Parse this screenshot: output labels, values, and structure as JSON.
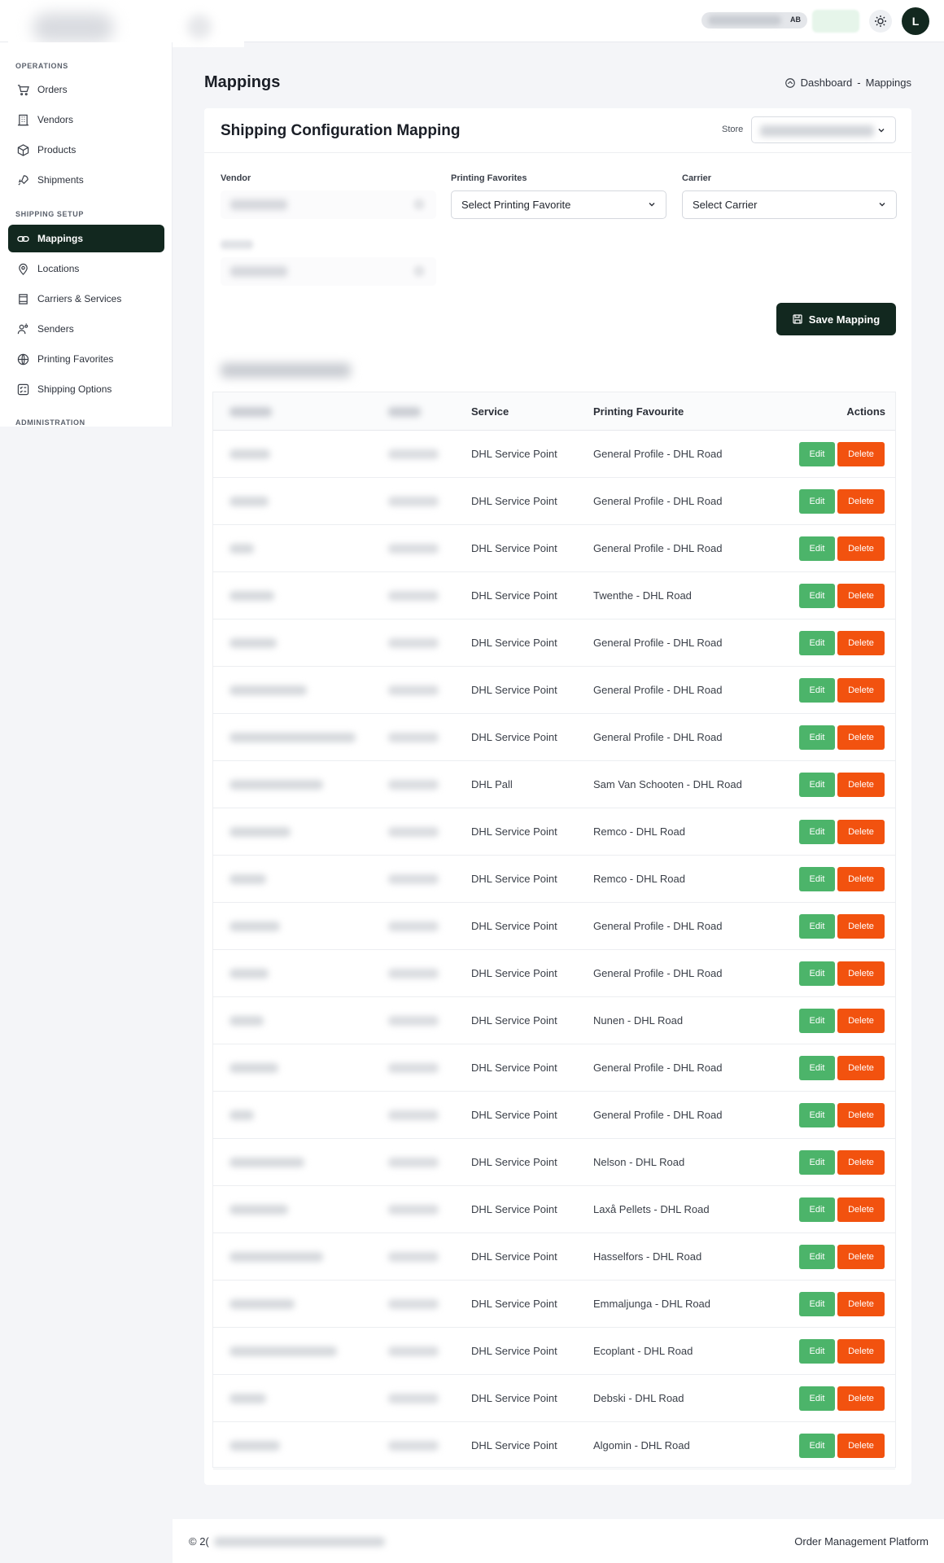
{
  "header": {
    "account_badge": "AB",
    "avatar_initial": "L"
  },
  "sidebar": {
    "sections": [
      {
        "title": "OPERATIONS"
      },
      {
        "title": "SHIPPING SETUP"
      },
      {
        "title": "ADMINISTRATION"
      }
    ],
    "items": [
      {
        "label": "Orders",
        "icon": "cart-icon"
      },
      {
        "label": "Vendors",
        "icon": "building-icon"
      },
      {
        "label": "Products",
        "icon": "box-icon"
      },
      {
        "label": "Shipments",
        "icon": "rocket-icon"
      },
      {
        "label": "Mappings",
        "icon": "link-icon",
        "active": true
      },
      {
        "label": "Locations",
        "icon": "map-pin-icon"
      },
      {
        "label": "Carriers & Services",
        "icon": "truck-icon"
      },
      {
        "label": "Senders",
        "icon": "users-icon"
      },
      {
        "label": "Printing Favorites",
        "icon": "printer-icon"
      },
      {
        "label": "Shipping Options",
        "icon": "options-icon"
      }
    ]
  },
  "page": {
    "title": "Mappings",
    "breadcrumb": {
      "home": "Dashboard",
      "separator": "-",
      "current": "Mappings"
    }
  },
  "card": {
    "title": "Shipping Configuration Mapping",
    "store_label": "Store",
    "vendor_label": "Vendor",
    "printing_label": "Printing Favorites",
    "printing_placeholder": "Select Printing Favorite",
    "carrier_label": "Carrier",
    "carrier_placeholder": "Select Carrier",
    "save_label": "Save Mapping"
  },
  "table": {
    "headers": {
      "service": "Service",
      "printing": "Printing Favourite",
      "actions": "Actions"
    },
    "edit_label": "Edit",
    "delete_label": "Delete",
    "rows": [
      {
        "service": "DHL Service Point",
        "printing": "General Profile - DHL Road"
      },
      {
        "service": "DHL Service Point",
        "printing": "General Profile - DHL Road"
      },
      {
        "service": "DHL Service Point",
        "printing": "General Profile - DHL Road"
      },
      {
        "service": "DHL Service Point",
        "printing": "Twenthe - DHL Road"
      },
      {
        "service": "DHL Service Point",
        "printing": "General Profile - DHL Road"
      },
      {
        "service": "DHL Service Point",
        "printing": "General Profile - DHL Road"
      },
      {
        "service": "DHL Service Point",
        "printing": "General Profile - DHL Road"
      },
      {
        "service": "DHL Pall",
        "printing": "Sam Van Schooten - DHL Road"
      },
      {
        "service": "DHL Service Point",
        "printing": "Remco - DHL Road"
      },
      {
        "service": "DHL Service Point",
        "printing": "Remco - DHL Road"
      },
      {
        "service": "DHL Service Point",
        "printing": "General Profile - DHL Road"
      },
      {
        "service": "DHL Service Point",
        "printing": "General Profile - DHL Road"
      },
      {
        "service": "DHL Service Point",
        "printing": "Nunen - DHL Road"
      },
      {
        "service": "DHL Service Point",
        "printing": "General Profile - DHL Road"
      },
      {
        "service": "DHL Service Point",
        "printing": "General Profile - DHL Road"
      },
      {
        "service": "DHL Service Point",
        "printing": "Nelson - DHL Road"
      },
      {
        "service": "DHL Service Point",
        "printing": "Laxå Pellets - DHL Road"
      },
      {
        "service": "DHL Service Point",
        "printing": "Hasselfors - DHL Road"
      },
      {
        "service": "DHL Service Point",
        "printing": "Emmaljunga - DHL Road"
      },
      {
        "service": "DHL Service Point",
        "printing": "Ecoplant - DHL Road"
      },
      {
        "service": "DHL Service Point",
        "printing": "Debski - DHL Road"
      },
      {
        "service": "DHL Service Point",
        "printing": "Algomin - DHL Road"
      }
    ]
  },
  "footer": {
    "copyright": "© 2(",
    "app_name": "Order Management Platform"
  }
}
